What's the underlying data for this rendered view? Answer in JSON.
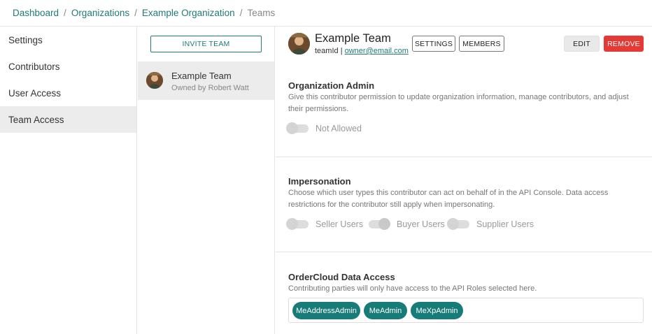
{
  "breadcrumb": {
    "items": [
      "Dashboard",
      "Organizations",
      "Example Organization"
    ],
    "current": "Teams",
    "separator": "/"
  },
  "sidebar": {
    "items": [
      {
        "label": "Settings",
        "active": false
      },
      {
        "label": "Contributors",
        "active": false
      },
      {
        "label": "User Access",
        "active": false
      },
      {
        "label": "Team Access",
        "active": true
      }
    ]
  },
  "teams_panel": {
    "invite_label": "INVITE TEAM",
    "team": {
      "name": "Example Team",
      "owner": "Owned by Robert Watt"
    }
  },
  "detail": {
    "title": "Example Team",
    "team_id": "teamId",
    "owner_email": "owner@email.com",
    "buttons": {
      "settings": "SETTINGS",
      "members": "MEMBERS",
      "edit": "EDIT",
      "remove": "REMOVE"
    },
    "org_admin": {
      "title": "Organization Admin",
      "description": "Give this contributor permission to update organization information, manage contributors, and adjust their permissions.",
      "toggle_label": "Not Allowed",
      "toggle_on": false
    },
    "impersonation": {
      "title": "Impersonation",
      "description": "Choose which user types this contributor can act on behalf of in the API Console. Data access restrictions for the contributor still apply when impersonating.",
      "toggles": [
        {
          "label": "Seller Users",
          "on": false
        },
        {
          "label": "Buyer Users",
          "on": true
        },
        {
          "label": "Supplier Users",
          "on": false
        }
      ]
    },
    "data_access": {
      "title": "OrderCloud Data Access",
      "description": "Contributing parties will only have access to the API Roles selected here.",
      "roles": [
        "MeAddressAdmin",
        "MeAdmin",
        "MeXpAdmin"
      ]
    }
  },
  "colors": {
    "accent": "#1f7a78",
    "chip": "#177c78",
    "danger": "#e53935",
    "active_bg": "#ececec"
  },
  "icons": {
    "avatar": "user-avatar-photo"
  }
}
